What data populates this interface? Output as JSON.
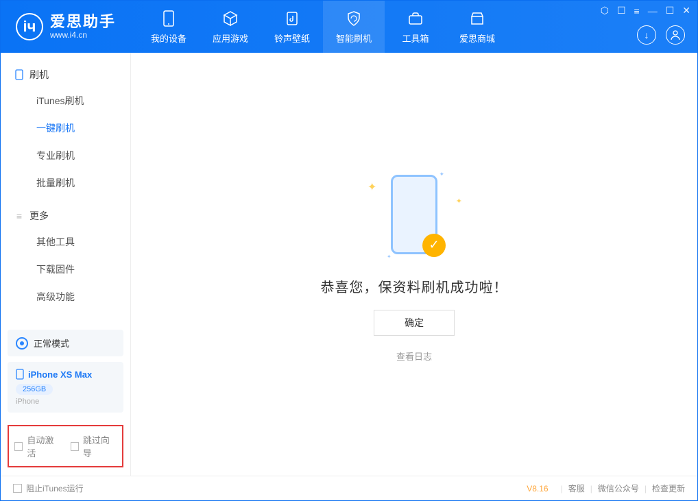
{
  "brand": {
    "cn": "爱思助手",
    "url": "www.i4.cn"
  },
  "tabs": {
    "device": "我的设备",
    "apps": "应用游戏",
    "ring": "铃声壁纸",
    "flash": "智能刷机",
    "tools": "工具箱",
    "store": "爱思商城"
  },
  "sidebar": {
    "section_flash": "刷机",
    "items_flash": {
      "itunes": "iTunes刷机",
      "oneclick": "一键刷机",
      "pro": "专业刷机",
      "batch": "批量刷机"
    },
    "section_more": "更多",
    "items_more": {
      "other": "其他工具",
      "firmware": "下载固件",
      "advanced": "高级功能"
    }
  },
  "device": {
    "mode": "正常模式",
    "model": "iPhone XS Max",
    "storage": "256GB",
    "family": "iPhone"
  },
  "options": {
    "auto_activate": "自动激活",
    "skip_guide": "跳过向导"
  },
  "result": {
    "message": "恭喜您，保资料刷机成功啦！",
    "ok": "确定",
    "log": "查看日志"
  },
  "footer": {
    "block_itunes": "阻止iTunes运行",
    "version": "V8.16",
    "support": "客服",
    "wechat": "微信公众号",
    "update": "检查更新"
  }
}
